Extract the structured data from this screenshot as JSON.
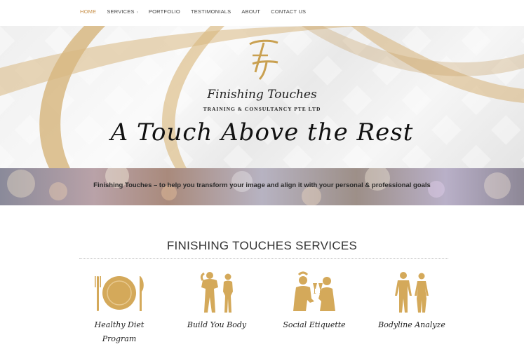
{
  "nav": {
    "items": [
      {
        "label": "HOME",
        "active": true
      },
      {
        "label": "SERVICES",
        "active": false,
        "has_dropdown": true
      },
      {
        "label": "PORTFOLIO",
        "active": false
      },
      {
        "label": "TESTIMONIALS",
        "active": false
      },
      {
        "label": "ABOUT",
        "active": false
      },
      {
        "label": "CONTACT US",
        "active": false
      }
    ],
    "dropdown_caret": "›"
  },
  "hero": {
    "monogram": "FT",
    "brand_name": "Finishing Touches",
    "brand_subtitle": "TRAINING & CONSULTANCY PTE LTD",
    "tagline": "A Touch Above the Rest"
  },
  "band": {
    "text": "Finishing Touches – to help you transform your image and align it with your personal & professional goals"
  },
  "services": {
    "title": "FINISHING TOUCHES SERVICES",
    "items": [
      {
        "label": "Healthy Diet Program",
        "icon": "plate-cutlery-icon"
      },
      {
        "label": "Build You Body",
        "icon": "couple-fitness-icon"
      },
      {
        "label": "Social Etiquette",
        "icon": "social-toast-icon"
      },
      {
        "label": "Bodyline Analyze",
        "icon": "body-figures-icon"
      }
    ]
  },
  "colors": {
    "accent_gold": "#d4a95a",
    "nav_active": "#c8904a"
  }
}
